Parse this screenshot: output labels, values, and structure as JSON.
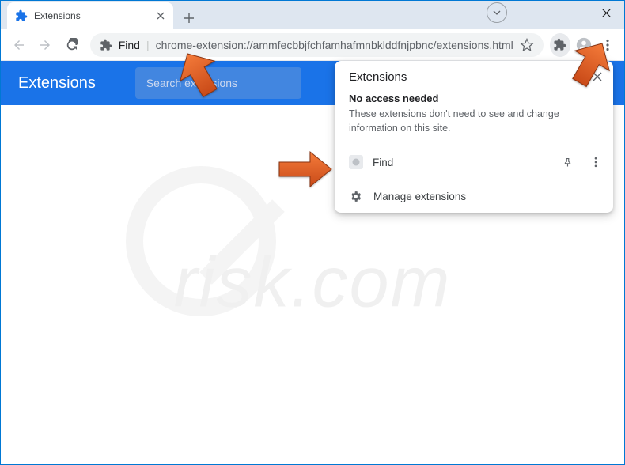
{
  "window": {
    "tab_title": "Extensions"
  },
  "address": {
    "ext_name": "Find",
    "url": "chrome-extension://ammfecbbjfchfamhafmnbklddfnjpbnc/extensions.html"
  },
  "page": {
    "title": "Extensions",
    "search_placeholder": "Search extensions"
  },
  "popup": {
    "title": "Extensions",
    "section_title": "No access needed",
    "section_desc": "These extensions don't need to see and change information on this site.",
    "ext_name": "Find",
    "manage_label": "Manage extensions"
  },
  "watermark": {
    "text": "risk.com"
  }
}
